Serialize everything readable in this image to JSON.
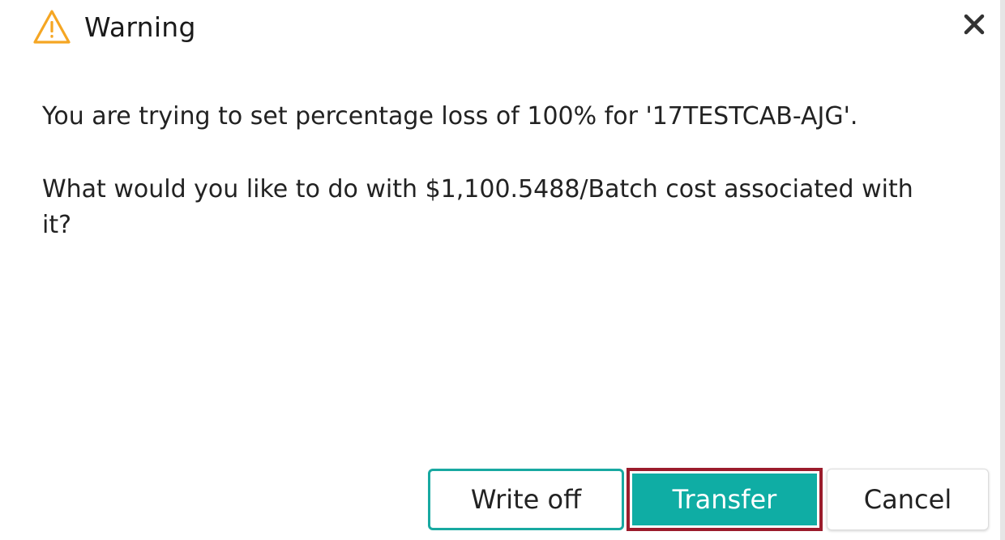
{
  "dialog": {
    "title": "Warning",
    "icon": "warning-triangle-icon",
    "close_icon": "close-icon",
    "message_line1": "You are trying to set percentage loss of 100% for '17TESTCAB-AJG'.",
    "message_line2": "What would you like to do with $1,100.5488/Batch cost associated with it?",
    "buttons": {
      "write_off": "Write off",
      "transfer": "Transfer",
      "cancel": "Cancel"
    }
  },
  "colors": {
    "accent": "#0fada4",
    "warning": "#f5a623",
    "focus_outline": "#9b1c2c"
  }
}
